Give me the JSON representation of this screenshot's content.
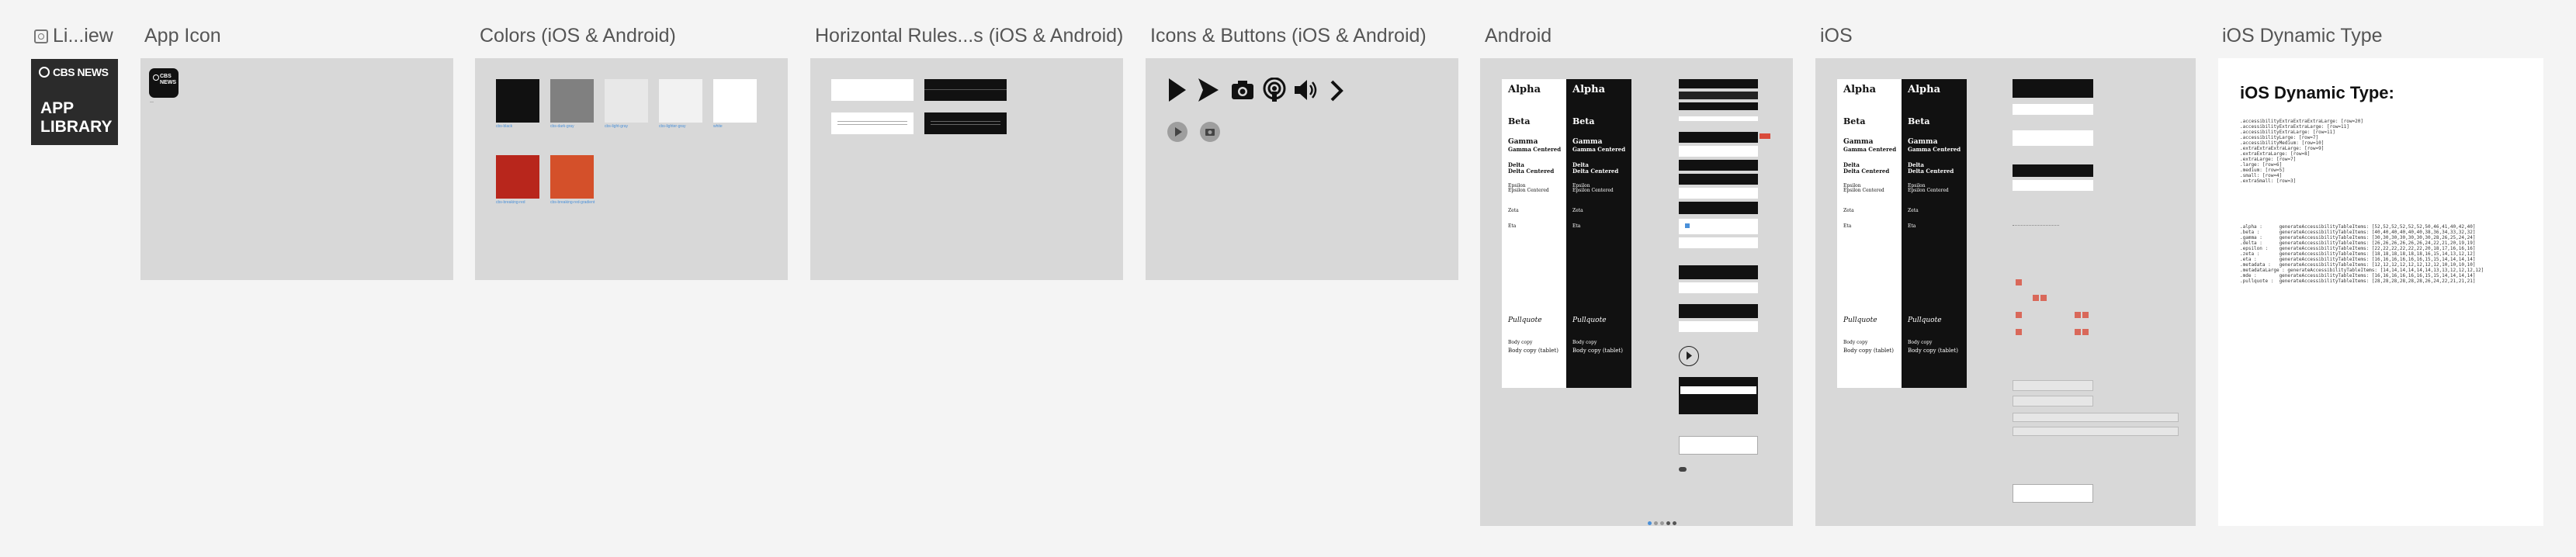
{
  "frames": {
    "library": {
      "title": "Li...iew"
    },
    "app_icon": {
      "title": "App Icon",
      "caption": "—"
    },
    "colors": {
      "title": "Colors (iOS & Android)",
      "swatches": [
        {
          "color": "#111111",
          "label": "cbs-black"
        },
        {
          "color": "#808080",
          "label": "cbs-dark-gray"
        },
        {
          "color": "#e8e8e8",
          "label": "cbs-light-gray"
        },
        {
          "color": "#f2f2f2",
          "label": "cbs-lighter-gray"
        },
        {
          "color": "#ffffff",
          "label": "white"
        },
        {
          "color": "#b8261c",
          "label": "cbs-breaking-red"
        },
        {
          "color": "#d4502a",
          "label": "cbs-breaking-red-gradient"
        }
      ]
    },
    "rules": {
      "title": "Horizontal Rules...s (iOS & Android)"
    },
    "icons": {
      "title": "Icons & Buttons (iOS & Android)"
    },
    "android": {
      "title": "Android"
    },
    "ios": {
      "title": "iOS"
    },
    "dynamic_type": {
      "title": "iOS Dynamic Type",
      "heading": "iOS Dynamic Type:",
      "lines_a": [
        ".accessibilityExtraExtraExtraLarge: [row=20]",
        ".accessibilityExtraExtraLarge: [row=11]",
        ".accessibilityExtraLarge: [row=11]",
        ".accessibilityLarge: [row=7]",
        ".accessibilityMedium: [row=10]",
        ".extraExtraExtraLarge: [row=9]",
        ".extraExtraLarge: [row=8]",
        ".extraLarge: [row=7]",
        ".large: [row=6]",
        ".medium: [row=5]",
        ".small: [row=4]",
        ".extraSmall: [row=3]"
      ],
      "lines_b": [
        ".alpha :      generateAccessibilityTableItems: [52,52,52,52,52,52,50,46,41,40,42,40]",
        ".beta :       generateAccessibilityTableItems: [40,40,40,40,40,40,38,36,34,33,32,32]",
        ".gamma :      generateAccessibilityTableItems: [30,30,30,30,30,30,30,28,26,25,24,24]",
        ".delta :      generateAccessibilityTableItems: [26,26,26,26,26,26,24,22,21,20,19,19]",
        ".epsilon :    generateAccessibilityTableItems: [22,22,22,22,22,22,20,18,17,16,16,16]",
        ".zeta :       generateAccessibilityTableItems: [18,18,18,18,18,18,16,15,14,13,12,12]",
        ".eta :        generateAccessibilityTableItems: [16,16,16,16,16,16,15,15,14,14,14,14]",
        ".metadata :   generateAccessibilityTableItems: [12,12,12,12,12,12,12,12,10,10,10,10]",
        ".metadataLarge : generateAccessibilityTableItems: [14,14,14,14,14,14,13,13,12,12,12,12]",
        ".mde :        generateAccessibilityTableItems: [16,16,16,16,16,16,15,15,14,14,14,14]",
        ".pullquote :  generateAccessibilityTableItems: [28,28,28,28,28,28,26,24,22,21,21,21]"
      ]
    }
  },
  "logo": {
    "brand": "CBS NEWS",
    "line1": "APP",
    "line2": "LIBRARY"
  },
  "mini_icon": {
    "brand": "CBS NEWS"
  },
  "type_sample": {
    "alpha": "Alpha",
    "beta": "Beta",
    "gamma": "Gamma",
    "gamma_centered": "Gamma Centered",
    "delta": "Delta",
    "delta_centered": "Delta Centered",
    "epsilon": "Epsilon",
    "epsilon_centered": "Epsilon Centered",
    "zeta": "Zeta",
    "eta": "Eta",
    "pullquote": "Pullquote",
    "body": "Body copy",
    "body_regular": "Body copy (tablet)"
  }
}
